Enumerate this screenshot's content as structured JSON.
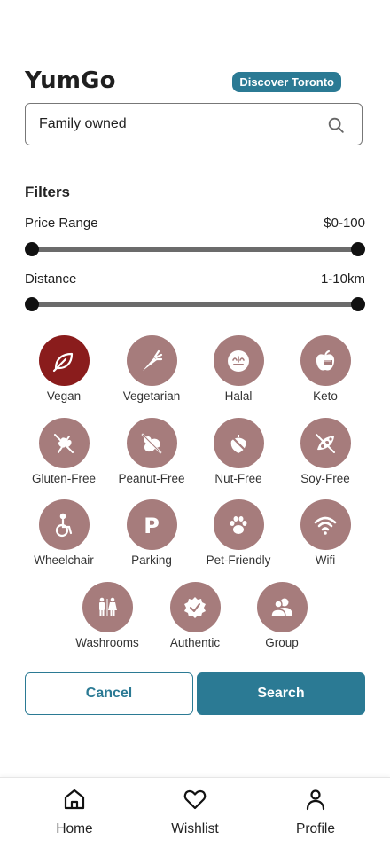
{
  "app": {
    "title": "YumGo",
    "badge": "Discover Toronto"
  },
  "search": {
    "value": "Family owned",
    "icon": "search-icon"
  },
  "filters": {
    "title": "Filters",
    "price": {
      "label": "Price Range",
      "value": "$0-100"
    },
    "distance": {
      "label": "Distance",
      "value": "1-10km"
    }
  },
  "chips": [
    {
      "label": "Vegan",
      "icon": "leaf-icon",
      "active": true
    },
    {
      "label": "Vegetarian",
      "icon": "carrot-icon",
      "active": false
    },
    {
      "label": "Halal",
      "icon": "halal-icon",
      "active": false
    },
    {
      "label": "Keto",
      "icon": "apple-tape-icon",
      "active": false
    },
    {
      "label": "Gluten-Free",
      "icon": "wheat-crossed-icon",
      "active": false
    },
    {
      "label": "Peanut-Free",
      "icon": "peanut-crossed-icon",
      "active": false
    },
    {
      "label": "Nut-Free",
      "icon": "nut-crossed-icon",
      "active": false
    },
    {
      "label": "Soy-Free",
      "icon": "soy-crossed-icon",
      "active": false
    },
    {
      "label": "Wheelchair",
      "icon": "wheelchair-icon",
      "active": false
    },
    {
      "label": "Parking",
      "icon": "parking-icon",
      "active": false
    },
    {
      "label": "Pet-Friendly",
      "icon": "paw-icon",
      "active": false
    },
    {
      "label": "Wifi",
      "icon": "wifi-icon",
      "active": false
    },
    {
      "label": "Washrooms",
      "icon": "washroom-icon",
      "active": false
    },
    {
      "label": "Authentic",
      "icon": "badge-check-icon",
      "active": false
    },
    {
      "label": "Group",
      "icon": "group-icon",
      "active": false
    }
  ],
  "actions": {
    "cancel": "Cancel",
    "search": "Search"
  },
  "nav": [
    {
      "label": "Home",
      "icon": "home-icon"
    },
    {
      "label": "Wishlist",
      "icon": "heart-icon"
    },
    {
      "label": "Profile",
      "icon": "person-icon"
    }
  ],
  "colors": {
    "accent": "#2b7a94",
    "chip": "#a67c7c",
    "chip_active": "#8a1c1c"
  }
}
